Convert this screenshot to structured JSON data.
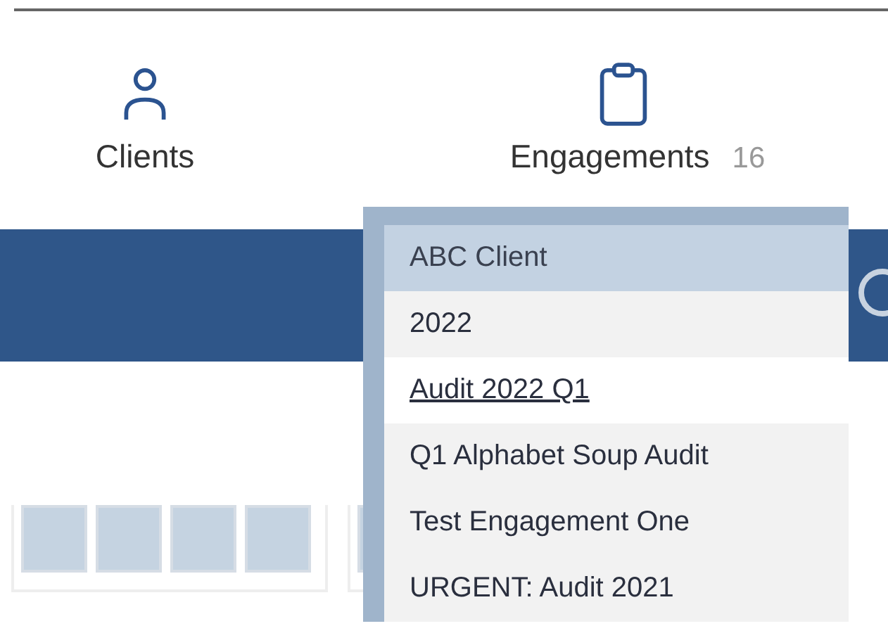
{
  "nav": [
    {
      "kind": "person",
      "label": "Clients"
    },
    {
      "kind": "clipboard",
      "label": "Engagements",
      "count": "16"
    }
  ],
  "dropdown": {
    "items": [
      {
        "label": "ABC Client",
        "selected": true,
        "hovered": false
      },
      {
        "label": "2022",
        "selected": false,
        "hovered": false
      },
      {
        "label": "Audit 2022 Q1",
        "selected": false,
        "hovered": true
      },
      {
        "label": "Q1 Alphabet Soup Audit",
        "selected": false,
        "hovered": false
      },
      {
        "label": "Test Engagement One",
        "selected": false,
        "hovered": false
      },
      {
        "label": "URGENT: Audit 2021",
        "selected": false,
        "hovered": false
      }
    ]
  }
}
